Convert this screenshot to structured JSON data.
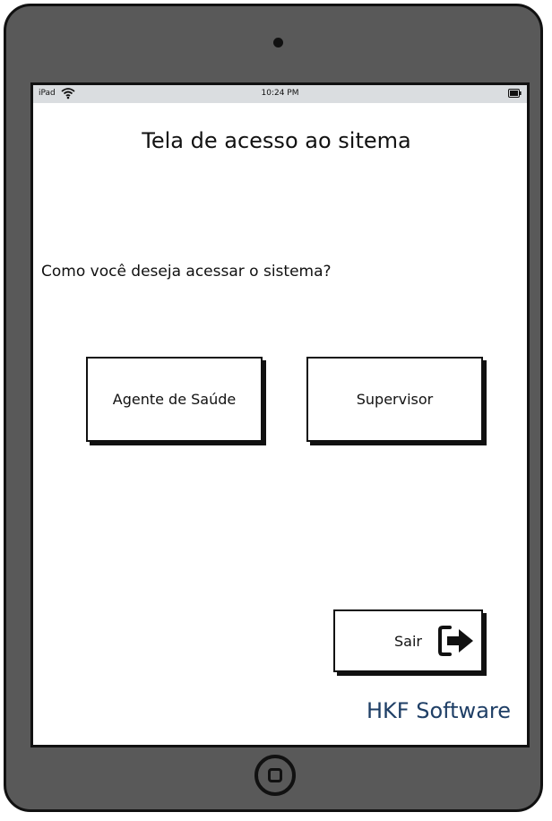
{
  "device": {
    "frame_color": "#595959",
    "home_button_icon": "home-square-icon"
  },
  "status_bar": {
    "device_name": "iPad",
    "time": "10:24 PM",
    "icons": [
      "wifi-icon",
      "battery-icon"
    ]
  },
  "screen": {
    "title": "Tela de acesso ao sitema",
    "prompt": "Como você deseja acessar o sistema?",
    "buttons": {
      "agente": "Agente de Saúde",
      "supervisor": "Supervisor",
      "sair": "Sair"
    },
    "exit_icon": "exit-arrow-icon",
    "brand": "HKF Software",
    "brand_color": "#1f3f66"
  }
}
